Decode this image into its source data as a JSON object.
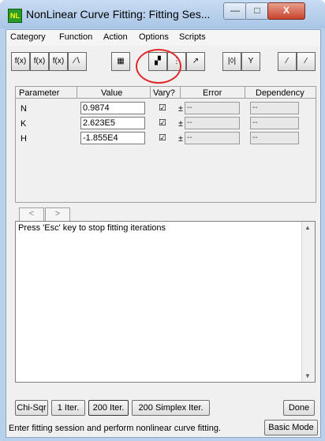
{
  "window": {
    "title": "NonLinear Curve Fitting:  Fitting Ses...",
    "icon_text": "NL",
    "min_label": "—",
    "max_label": "□",
    "close_label": "X"
  },
  "menu": [
    "Category",
    "Function",
    "Action",
    "Options",
    "Scripts"
  ],
  "toolbar": [
    {
      "icon": "formula-check-icon",
      "text": "f(x)"
    },
    {
      "icon": "formula-edit-icon",
      "text": "f(x)"
    },
    {
      "icon": "formula-new-icon",
      "text": "f(x)"
    },
    {
      "icon": "curve-plot-icon",
      "text": "∕∖"
    },
    {
      "icon": "worksheet-icon",
      "text": "▦"
    },
    {
      "icon": "graph-activate-icon",
      "text": "▞"
    },
    {
      "icon": "dataset-select-icon",
      "text": "⋮"
    },
    {
      "icon": "simulate-curve-icon",
      "text": "↗"
    },
    {
      "icon": "parameter-bound-icon",
      "text": "|◊|"
    },
    {
      "icon": "weight-filter-icon",
      "text": "Y"
    },
    {
      "icon": "fit-curve-icon",
      "text": "⁄"
    },
    {
      "icon": "residual-plot-icon",
      "text": "⁄"
    }
  ],
  "params": {
    "headers": [
      "Parameter",
      "Value",
      "Vary?",
      "Error",
      "Dependency"
    ],
    "rows": [
      {
        "name": "N",
        "value": "0.9874",
        "vary": "☑",
        "pm": "±",
        "error": "--",
        "dependency": "--"
      },
      {
        "name": "K",
        "value": "2.623E5",
        "vary": "☑",
        "pm": "±",
        "error": "--",
        "dependency": "--"
      },
      {
        "name": "H",
        "value": "-1.855E4",
        "vary": "☑",
        "pm": "±",
        "error": "--",
        "dependency": "--"
      }
    ]
  },
  "nav": {
    "prev": "<",
    "next": ">"
  },
  "output": {
    "text": "Press 'Esc' key to stop fitting iterations"
  },
  "buttons": {
    "chisqr": "Chi-Sqr",
    "iter1": "1 Iter.",
    "iter200": "200 Iter.",
    "simplex": "200 Simplex Iter.",
    "done": "Done",
    "basic_mode": "Basic Mode"
  },
  "status": "Enter fitting session and perform nonlinear curve fitting."
}
